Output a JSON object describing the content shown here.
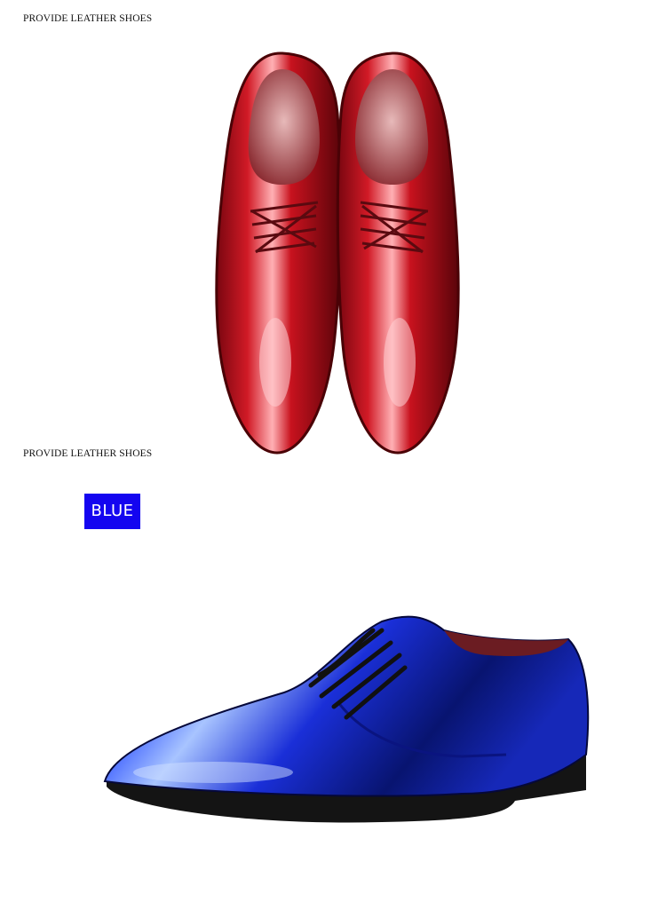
{
  "sections": {
    "top_caption": "PROVIDE LEATHER SHOES",
    "middle_caption": "PROVIDE LEATHER SHOES"
  },
  "badge": {
    "label": "BLUE",
    "color": "#1405f0"
  },
  "photos": {
    "red_pair": {
      "icon": "red-patent-leather-shoes-pair",
      "color": "#c0141e"
    },
    "blue_single": {
      "icon": "blue-patent-leather-shoe",
      "color": "#1a2fd8"
    }
  }
}
